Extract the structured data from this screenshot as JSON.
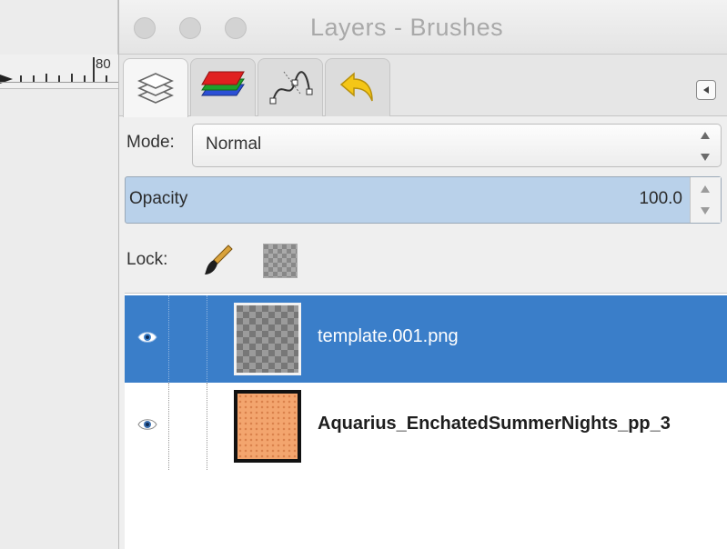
{
  "window": {
    "title": "Layers - Brushes"
  },
  "ruler": {
    "number": "80"
  },
  "tabs": [
    {
      "name": "layers-tab",
      "icon": "layers-icon",
      "active": true
    },
    {
      "name": "channels-tab",
      "icon": "channels-icon",
      "active": false
    },
    {
      "name": "paths-tab",
      "icon": "paths-icon",
      "active": false
    },
    {
      "name": "undo-history-tab",
      "icon": "undo-icon",
      "active": false
    }
  ],
  "mode": {
    "label": "Mode:",
    "value": "Normal"
  },
  "opacity": {
    "label": "Opacity",
    "value": "100.0"
  },
  "lock": {
    "label": "Lock:",
    "pixels_icon": "paintbrush-icon",
    "alpha_icon": "checkerboard-icon"
  },
  "layers": [
    {
      "name": "template.001.png",
      "visible": true,
      "selected": true,
      "thumbnail": "transparent-checker"
    },
    {
      "name": "Aquarius_EnchatedSummerNights_pp_3",
      "visible": true,
      "selected": false,
      "thumbnail": "orange-pattern"
    }
  ],
  "colors": {
    "selection": "#3a7ec9",
    "opacity_bar": "#b9d1ea",
    "channel_red": "#e02020",
    "channel_green": "#1fa02c",
    "channel_blue": "#2b4fd6",
    "undo_yellow": "#f4c617"
  }
}
